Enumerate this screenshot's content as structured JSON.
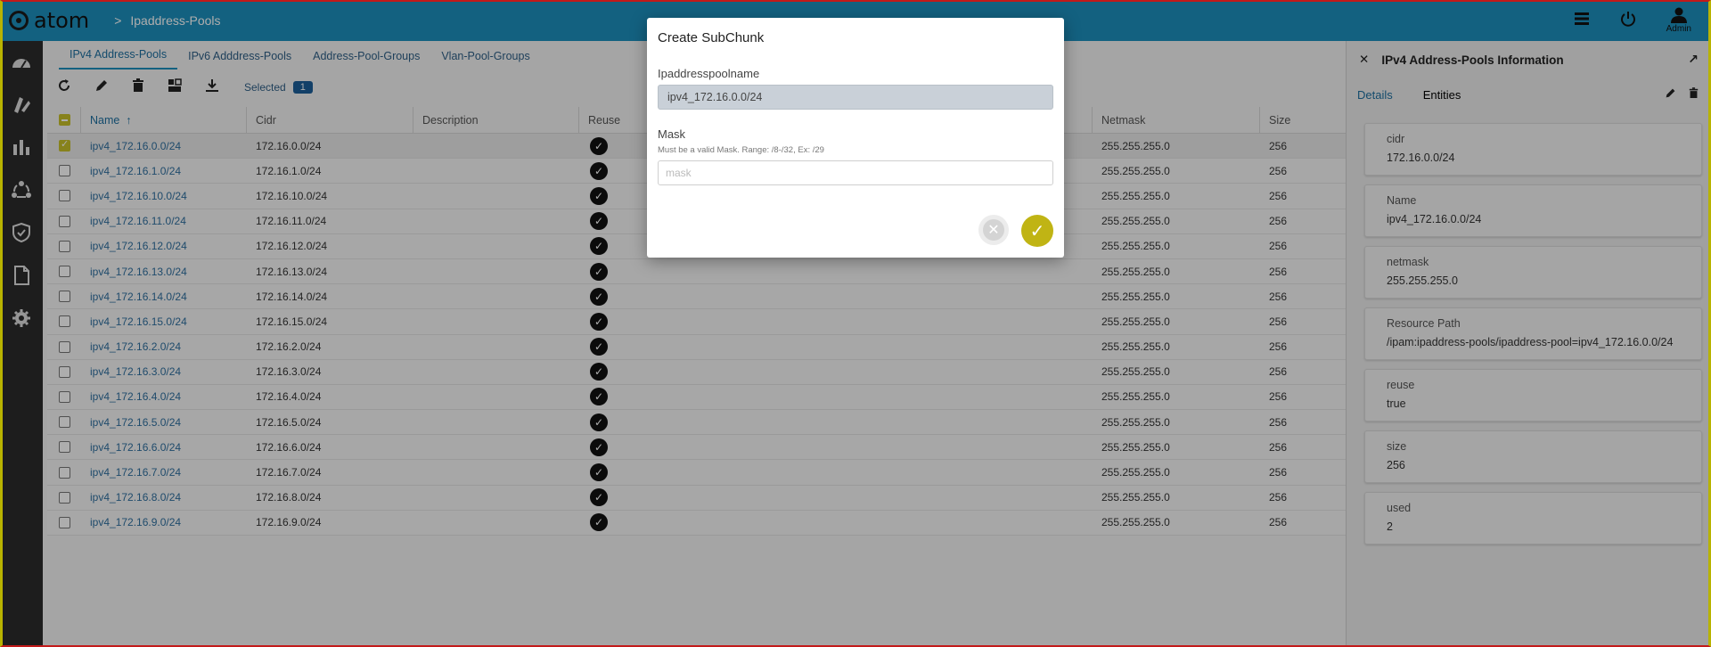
{
  "app": {
    "logo_text": "atom",
    "breadcrumb": "Ipaddress-Pools",
    "user_label": "Admin"
  },
  "tabs": [
    "IPv4 Address-Pools",
    "IPv6 Adddress-Pools",
    "Address-Pool-Groups",
    "Vlan-Pool-Groups"
  ],
  "toolbar": {
    "selected_label": "Selected",
    "selected_count": "1"
  },
  "table": {
    "headers": {
      "name": "Name",
      "sort_arrow": "↑",
      "cidr": "Cidr",
      "description": "Description",
      "reuse": "Reuse",
      "netmask": "Netmask",
      "size": "Size"
    },
    "rows": [
      {
        "name": "ipv4_172.16.0.0/24",
        "cidr": "172.16.0.0/24",
        "netmask": "255.255.255.0",
        "size": "256",
        "selected": true
      },
      {
        "name": "ipv4_172.16.1.0/24",
        "cidr": "172.16.1.0/24",
        "netmask": "255.255.255.0",
        "size": "256"
      },
      {
        "name": "ipv4_172.16.10.0/24",
        "cidr": "172.16.10.0/24",
        "netmask": "255.255.255.0",
        "size": "256"
      },
      {
        "name": "ipv4_172.16.11.0/24",
        "cidr": "172.16.11.0/24",
        "netmask": "255.255.255.0",
        "size": "256"
      },
      {
        "name": "ipv4_172.16.12.0/24",
        "cidr": "172.16.12.0/24",
        "netmask": "255.255.255.0",
        "size": "256"
      },
      {
        "name": "ipv4_172.16.13.0/24",
        "cidr": "172.16.13.0/24",
        "netmask": "255.255.255.0",
        "size": "256"
      },
      {
        "name": "ipv4_172.16.14.0/24",
        "cidr": "172.16.14.0/24",
        "netmask": "255.255.255.0",
        "size": "256"
      },
      {
        "name": "ipv4_172.16.15.0/24",
        "cidr": "172.16.15.0/24",
        "netmask": "255.255.255.0",
        "size": "256"
      },
      {
        "name": "ipv4_172.16.2.0/24",
        "cidr": "172.16.2.0/24",
        "netmask": "255.255.255.0",
        "size": "256"
      },
      {
        "name": "ipv4_172.16.3.0/24",
        "cidr": "172.16.3.0/24",
        "netmask": "255.255.255.0",
        "size": "256"
      },
      {
        "name": "ipv4_172.16.4.0/24",
        "cidr": "172.16.4.0/24",
        "netmask": "255.255.255.0",
        "size": "256"
      },
      {
        "name": "ipv4_172.16.5.0/24",
        "cidr": "172.16.5.0/24",
        "netmask": "255.255.255.0",
        "size": "256"
      },
      {
        "name": "ipv4_172.16.6.0/24",
        "cidr": "172.16.6.0/24",
        "netmask": "255.255.255.0",
        "size": "256"
      },
      {
        "name": "ipv4_172.16.7.0/24",
        "cidr": "172.16.7.0/24",
        "netmask": "255.255.255.0",
        "size": "256"
      },
      {
        "name": "ipv4_172.16.8.0/24",
        "cidr": "172.16.8.0/24",
        "netmask": "255.255.255.0",
        "size": "256"
      },
      {
        "name": "ipv4_172.16.9.0/24",
        "cidr": "172.16.9.0/24",
        "netmask": "255.255.255.0",
        "size": "256"
      }
    ]
  },
  "panel": {
    "title": "IPv4 Address-Pools Information",
    "tabs": [
      "Details",
      "Entities"
    ],
    "cards": [
      {
        "label": "cidr",
        "value": "172.16.0.0/24"
      },
      {
        "label": "Name",
        "value": "ipv4_172.16.0.0/24"
      },
      {
        "label": "netmask",
        "value": "255.255.255.0"
      },
      {
        "label": "Resource Path",
        "value": "/ipam:ipaddress-pools/ipaddress-pool=ipv4_172.16.0.0/24"
      },
      {
        "label": "reuse",
        "value": "true"
      },
      {
        "label": "size",
        "value": "256"
      },
      {
        "label": "used",
        "value": "2"
      }
    ]
  },
  "modal": {
    "title": "Create SubChunk",
    "pool_label": "Ipaddresspoolname",
    "pool_value": "ipv4_172.16.0.0/24",
    "mask_label": "Mask",
    "mask_hint": "Must be a valid Mask. Range: /8-/32, Ex: /29",
    "mask_placeholder": "mask"
  },
  "colors": {
    "topbar": "#1d8fbd",
    "sidebar": "#2b2b2b",
    "accent": "#c0b414",
    "link": "#2f6f9f"
  },
  "icons": {
    "sidebar": [
      "dashboard-icon",
      "resources-icon",
      "chart-icon",
      "topology-icon",
      "shield-icon",
      "document-icon",
      "settings-icon"
    ],
    "toolbar": [
      "refresh-icon",
      "edit-icon",
      "delete-icon",
      "subchunk-icon",
      "download-icon"
    ]
  }
}
